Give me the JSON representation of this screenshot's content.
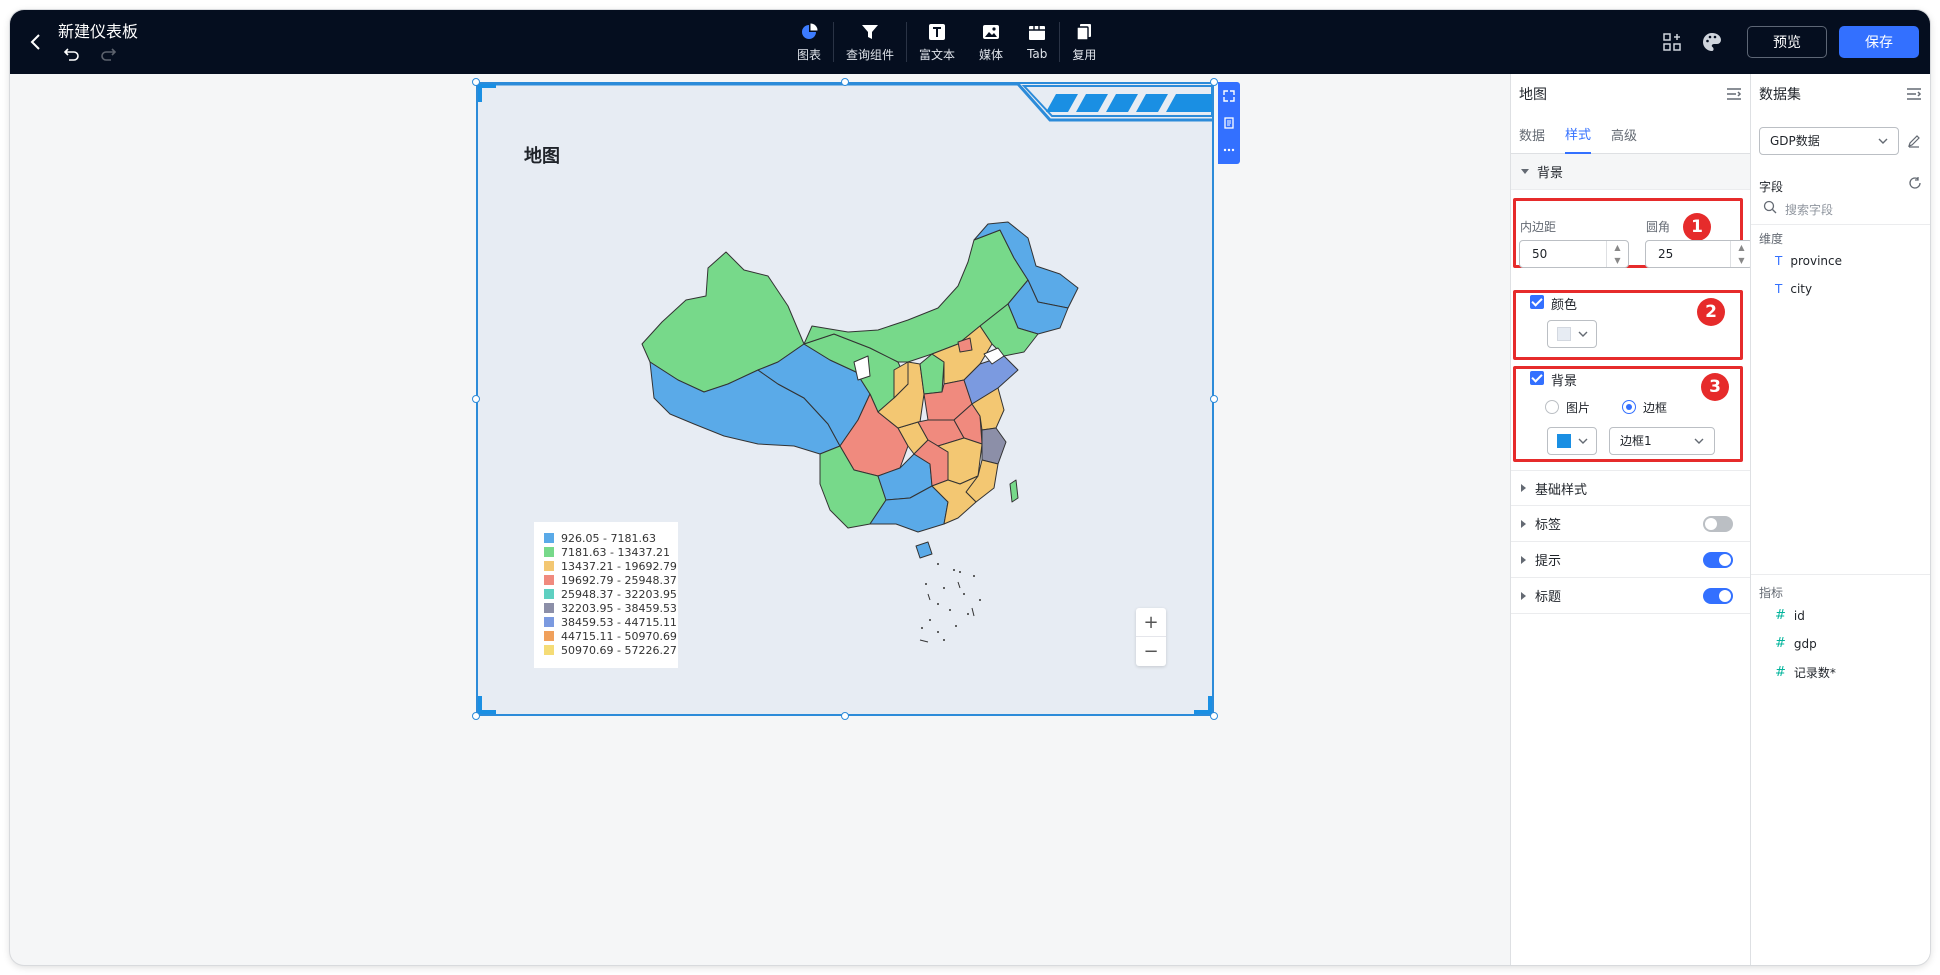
{
  "header": {
    "title": "新建仪表板",
    "toolbar": [
      {
        "icon": "pie-chart-icon",
        "label": "图表"
      },
      {
        "icon": "filter-icon",
        "label": "查询组件"
      },
      {
        "icon": "rich-text-icon",
        "label": "富文本"
      },
      {
        "icon": "image-icon",
        "label": "媒体"
      },
      {
        "icon": "tab-icon",
        "label": "Tab"
      },
      {
        "icon": "copy-icon",
        "label": "复用"
      }
    ],
    "preview_label": "预览",
    "save_label": "保存"
  },
  "widget": {
    "title": "地图",
    "legend": [
      {
        "range": "926.05 - 7181.63",
        "color": "#5aaae8"
      },
      {
        "range": "7181.63 - 13437.21",
        "color": "#77d98a"
      },
      {
        "range": "13437.21 - 19692.79",
        "color": "#f3c772"
      },
      {
        "range": "19692.79 - 25948.37",
        "color": "#f08a7e"
      },
      {
        "range": "25948.37 - 32203.95",
        "color": "#5ed0c1"
      },
      {
        "range": "32203.95 - 38459.53",
        "color": "#8c8fa8"
      },
      {
        "range": "38459.53 - 44715.11",
        "color": "#7b9ae0"
      },
      {
        "range": "44715.11 - 50970.69",
        "color": "#f0a05b"
      },
      {
        "range": "50970.69 - 57226.27",
        "color": "#f5dc76"
      }
    ],
    "zoom_in": "+",
    "zoom_out": "−"
  },
  "style_panel": {
    "title": "地图",
    "tabs": [
      "数据",
      "样式",
      "高级"
    ],
    "active_tab": "样式",
    "section_background": "背景",
    "padding_label": "内边距",
    "padding_value": "50",
    "radius_label": "圆角",
    "radius_value": "25",
    "color_label": "颜色",
    "color_value": "#e7ecf3",
    "bg_label": "背景",
    "radio_image": "图片",
    "radio_border": "边框",
    "border_color": "#1a8fe3",
    "border_style": "边框1",
    "badges": [
      "1",
      "2",
      "3"
    ],
    "sections": [
      {
        "label": "基础样式",
        "toggle": null
      },
      {
        "label": "标签",
        "toggle": false
      },
      {
        "label": "提示",
        "toggle": true
      },
      {
        "label": "标题",
        "toggle": true
      }
    ]
  },
  "dataset_panel": {
    "title": "数据集",
    "dataset": "GDP数据",
    "fields_label": "字段",
    "search_placeholder": "搜索字段",
    "dimension_label": "维度",
    "dimensions": [
      "province",
      "city"
    ],
    "metric_label": "指标",
    "metrics": [
      "id",
      "gdp",
      "记录数*"
    ]
  }
}
